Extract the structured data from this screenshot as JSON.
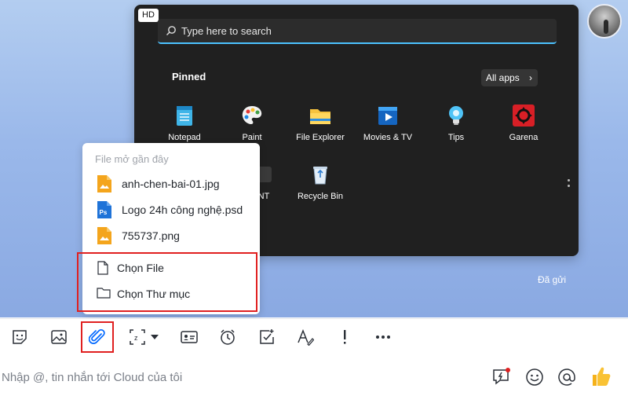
{
  "chat": {
    "sent_status": "Đã gửi",
    "image": {
      "hd_badge": "HD",
      "search_placeholder": "Type here to search",
      "pinned_label": "Pinned",
      "all_apps_label": "All apps",
      "apps": [
        {
          "label": "Notepad",
          "icon": "notepad-icon"
        },
        {
          "label": "Paint",
          "icon": "paint-icon"
        },
        {
          "label": "File Explorer",
          "icon": "folder-icon"
        },
        {
          "label": "Movies & TV",
          "icon": "movies-icon"
        },
        {
          "label": "Tips",
          "icon": "tips-icon"
        },
        {
          "label": "Garena",
          "icon": "garena-icon"
        },
        {
          "label": "NT",
          "icon": "app-icon"
        },
        {
          "label": "Recycle Bin",
          "icon": "recycle-bin-icon"
        }
      ]
    }
  },
  "attach_menu": {
    "recent_header": "File mở gần đây",
    "recent_files": [
      {
        "name": "anh-chen-bai-01.jpg",
        "icon": "image-file-icon"
      },
      {
        "name": "Logo 24h công nghệ.psd",
        "icon": "photoshop-file-icon"
      },
      {
        "name": "755737.png",
        "icon": "image-file-icon"
      }
    ],
    "choose_file": "Chọn File",
    "choose_folder": "Chọn Thư mục"
  },
  "toolbar": {
    "icons": [
      "sticker-icon",
      "image-icon",
      "attach-icon",
      "screenshot-icon",
      "contact-card-icon",
      "reminder-clock-icon",
      "task-icon",
      "text-format-icon",
      "urgent-icon",
      "more-icon"
    ]
  },
  "composer": {
    "placeholder": "Nhập @, tin nhắn tới Cloud của tôi",
    "icons": [
      "quick-message-icon",
      "emoji-icon",
      "mention-icon",
      "thumbs-up-icon"
    ]
  },
  "colors": {
    "highlight": "#e02020",
    "accent": "#0068ff",
    "chat_background": "#9ab8ea"
  }
}
